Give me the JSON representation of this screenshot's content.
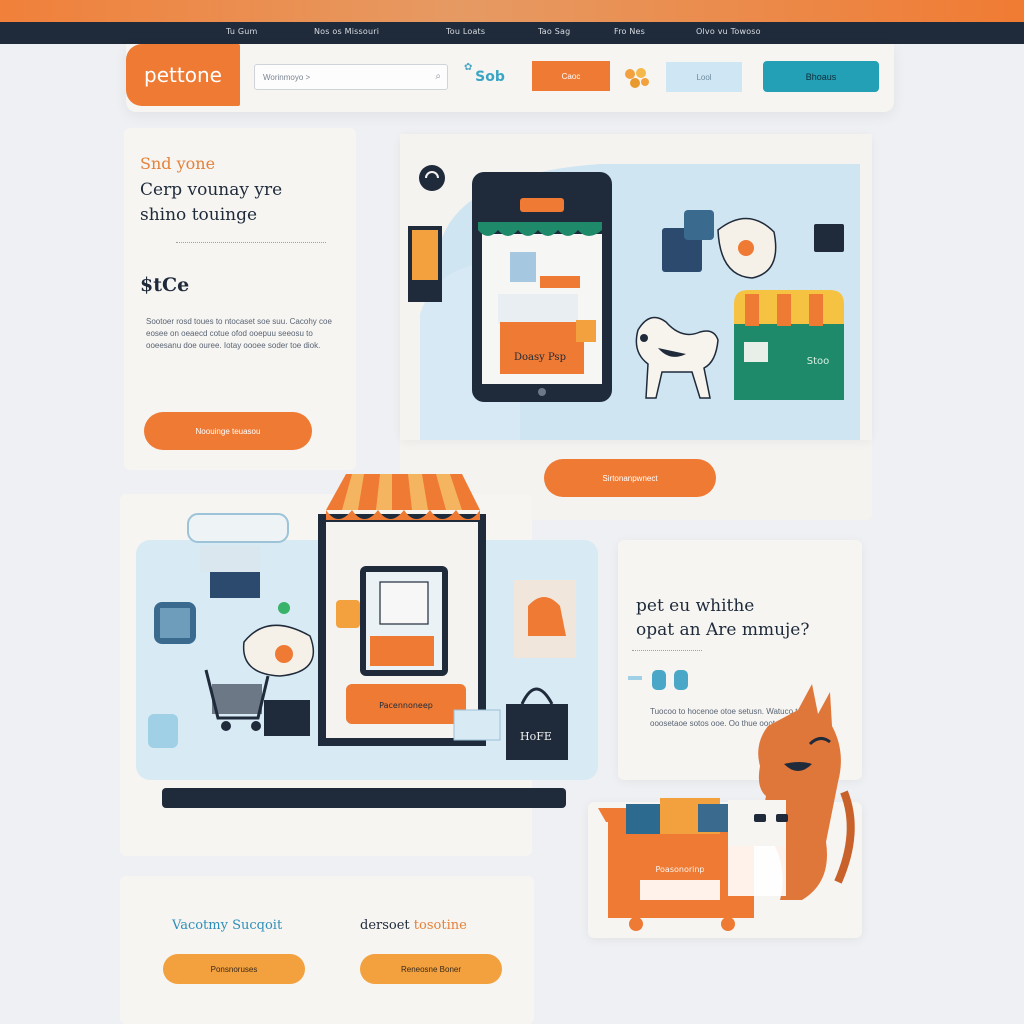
{
  "nav": {
    "links": [
      "Tu Gum",
      "Nos os Missouri",
      "Tou Loats",
      "Tao Sag",
      "Fro Nes",
      "Olvo vu Towoso"
    ]
  },
  "header": {
    "logo": "pettone",
    "search_placeholder": "Worinmoyo >",
    "shop_badge": "Sob",
    "btn_orange": "Caoc",
    "btn_light": "Lool",
    "btn_teal": "Bhoaus"
  },
  "hero": {
    "subtitle": "Snd yone",
    "title_line1": "Cerp vounay yre",
    "title_line2": "shino touinge",
    "price": "$tCe",
    "body": "Sootoer rosd toues to ntocaset soe suu. Cacohy coe eosee on oeaecd cotue ofod ooepuu seeosu to ooeesanu doe ouree. Iotay oooee soder toe diok.",
    "cta": "Noouinge teuasou",
    "cta2": "Sirtonanpwnect",
    "phone_screen_text": "Doasy Psp",
    "store_sign": "Stoo"
  },
  "mid": {
    "laptop_screen_text": "Pacennoneep",
    "bag_text": "HoFE"
  },
  "info": {
    "title_line1": "pet eu whithe",
    "title_line2": "opat an Are mmuje?",
    "body": "Tuocoo to hocenoe otoe setusn. Watuco toe ooosetaoe sotos ooe. Oo thue oootoss."
  },
  "bottom": {
    "heading1": "Vacotmy Sucqoit",
    "heading2_a": "dersoet",
    "heading2_b": "tosotine",
    "button1": "Ponsnoruses",
    "button2": "Reneosne Boner"
  },
  "basket": {
    "label": "Poasonorinp"
  },
  "colors": {
    "brand_orange": "#ef7a34",
    "navy": "#1f2a3a",
    "teal": "#23a0b6",
    "light_blue": "#d8eaf4",
    "green": "#1e8a6a",
    "amber": "#f2a13e"
  }
}
